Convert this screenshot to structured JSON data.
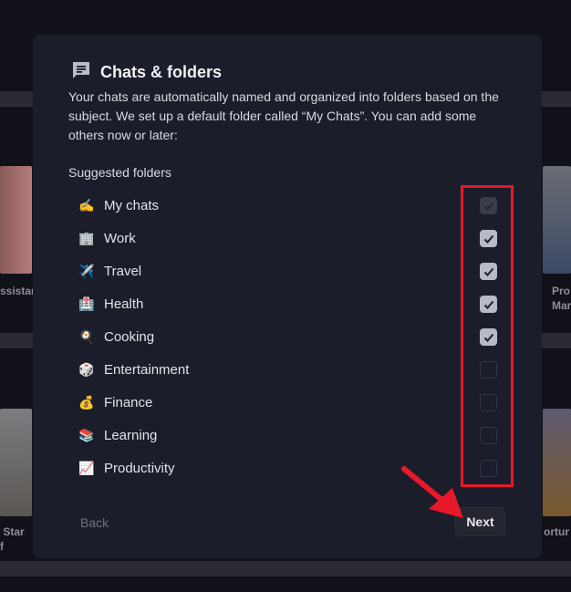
{
  "background": {
    "left_labels": [
      "ssistan",
      " Star",
      "f"
    ],
    "right_labels": [
      "Pro",
      "Mar",
      "ortur"
    ]
  },
  "modal": {
    "icon": "chat-bubble-icon",
    "title": "Chats & folders",
    "description": "Your chats are automatically named and organized into folders based on the subject. We set up a default folder called “My Chats”. You can add some others now or later:",
    "suggested_label": "Suggested folders",
    "folders": [
      {
        "emoji": "✍️",
        "label": "My chats",
        "checked": true,
        "disabled": true
      },
      {
        "emoji": "🏢",
        "label": "Work",
        "checked": true
      },
      {
        "emoji": "✈️",
        "label": "Travel",
        "checked": true
      },
      {
        "emoji": "🏥",
        "label": "Health",
        "checked": true
      },
      {
        "emoji": "🍳",
        "label": "Cooking",
        "checked": true
      },
      {
        "emoji": "🎲",
        "label": "Entertainment",
        "checked": false
      },
      {
        "emoji": "💰",
        "label": "Finance",
        "checked": false
      },
      {
        "emoji": "📚",
        "label": "Learning",
        "checked": false
      },
      {
        "emoji": "📈",
        "label": "Productivity",
        "checked": false
      }
    ],
    "back_label": "Back",
    "next_label": "Next"
  },
  "annotation_color": "#e8182a"
}
